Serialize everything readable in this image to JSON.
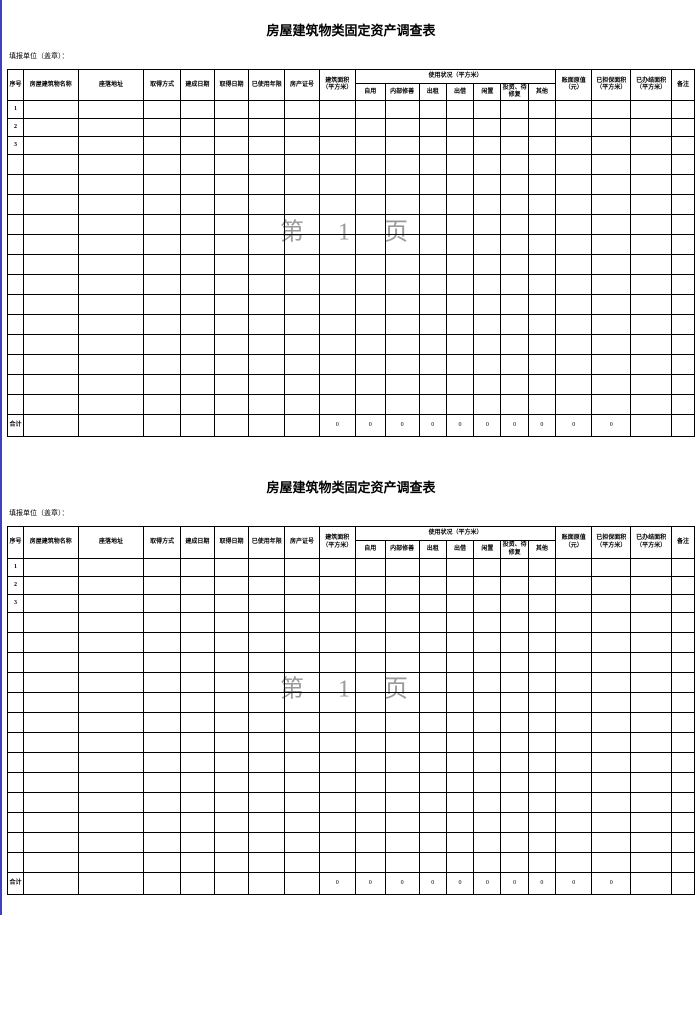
{
  "title": "房屋建筑物类固定资产调查表",
  "subtitle": "填报单位（盖章）：",
  "watermark": "第 1 页",
  "headers": {
    "seq": "序号",
    "name": "房屋建筑物名称",
    "addr": "座落地址",
    "method": "取得方式",
    "bdate": "建成日期",
    "adate": "取得日期",
    "years": "已使用年限",
    "cert": "房产证号",
    "area": "建筑面积（平方米）",
    "usage_group": "使用状况（平方米）",
    "use_self": "自用",
    "use_rent": "内部修善",
    "use_lease": "出租",
    "use_lend": "出借",
    "use_idle": "闲置",
    "use_inv": "投资、待修复",
    "use_other": "其他",
    "orig": "账面原值（元）",
    "warrant": "已担保面积（平方米）",
    "actual": "已办结面积（平方米）",
    "remark": "备注"
  },
  "row_numbers": [
    "1",
    "2",
    "3"
  ],
  "total_label": "合计",
  "total_values": [
    "0",
    "0",
    "0",
    "0",
    "0",
    "0",
    "0",
    "0",
    "0",
    "0"
  ],
  "blank_rows": 13
}
